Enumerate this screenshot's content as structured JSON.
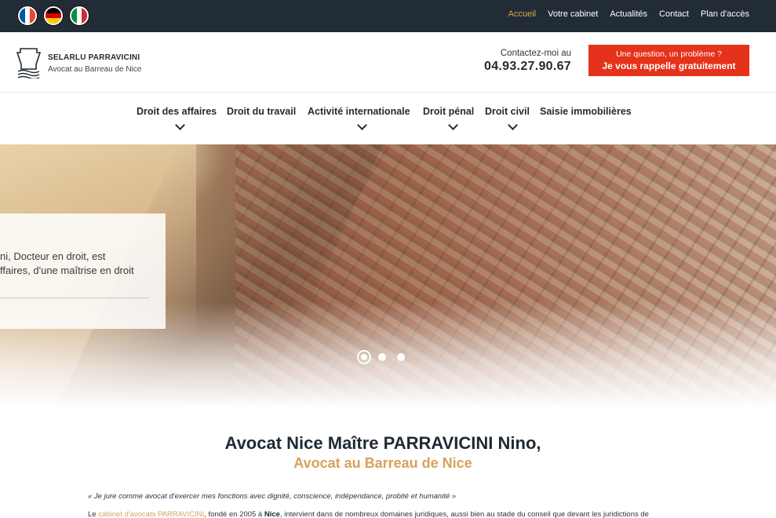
{
  "topbar": {
    "flags": [
      {
        "name": "french-flag-icon",
        "colors": [
          "#0055a4",
          "#ffffff",
          "#ef4135"
        ]
      },
      {
        "name": "german-flag-icon",
        "colors": [
          "#000000",
          "#dd0000",
          "#ffce00"
        ]
      },
      {
        "name": "italian-flag-icon",
        "colors": [
          "#009246",
          "#ffffff",
          "#ce2b37"
        ]
      }
    ],
    "nav": [
      "Accueil",
      "Votre cabinet",
      "Actualités",
      "Contact",
      "Plan d'accès"
    ],
    "active_color": "#d9a94a"
  },
  "header": {
    "brand_name": "SELARLU PARRAVICINI",
    "brand_sub": "Avocat au Barreau de Nice",
    "contact_label": "Contactez-moi au",
    "contact_phone": "04.93.27.90.67",
    "cta_line1": "Une question, un problème ?",
    "cta_line2": "Je vous rappelle gratuitement",
    "cta_color": "#e5321b"
  },
  "mainnav": [
    {
      "label": "Droit des affaires",
      "has_dropdown": true
    },
    {
      "label": "Droit du travail",
      "has_dropdown": false
    },
    {
      "label": "Activité internationale",
      "has_dropdown": true
    },
    {
      "label": "Droit pénal",
      "has_dropdown": true
    },
    {
      "label": "Droit civil",
      "has_dropdown": true
    },
    {
      "label": "Saisie immobilières",
      "has_dropdown": false
    }
  ],
  "hero": {
    "line1": "ni, Docteur en droit, est",
    "line2": "ffaires, d'une maîtrise en droit",
    "slides": 3,
    "active_slide": 1
  },
  "content": {
    "title": "Avocat Nice Maître PARRAVICINI Nino,",
    "subtitle": "Avocat au Barreau de Nice",
    "quote": "« Je jure comme avocat d'exercer mes fonctions avec dignité, conscience, indépendance, probité et humanité »",
    "para_prefix": "Le ",
    "para_link": "cabinet d'avocats PARRAVICINI",
    "para_mid": ", fondé en 2005 à ",
    "para_city": "Nice",
    "para_rest": ", intervient dans de nombreux domaines juridiques, aussi bien au stade du conseil que devant les juridictions de",
    "accent_color": "#d9a05a"
  }
}
